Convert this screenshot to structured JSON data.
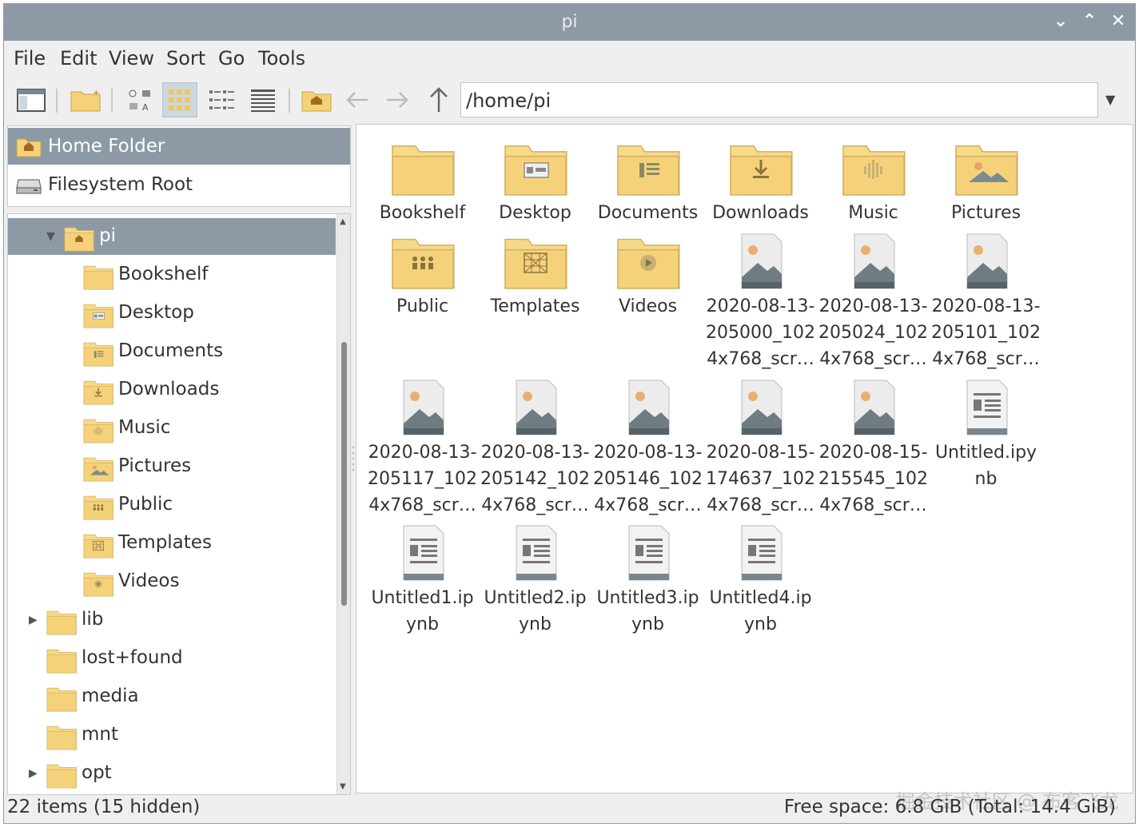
{
  "window": {
    "title": "pi"
  },
  "menubar": [
    "File",
    "Edit",
    "View",
    "Sort",
    "Go",
    "Tools"
  ],
  "path": "/home/pi",
  "places": [
    {
      "label": "Home Folder",
      "icon": "home-icon",
      "selected": true
    },
    {
      "label": "Filesystem Root",
      "icon": "drive-icon",
      "selected": false
    }
  ],
  "tree": [
    {
      "label": "pi",
      "level": 1,
      "expander": "down",
      "icon": "home-folder",
      "selected": true
    },
    {
      "label": "Bookshelf",
      "level": 2,
      "icon": "folder"
    },
    {
      "label": "Desktop",
      "level": 2,
      "icon": "desktop-folder"
    },
    {
      "label": "Documents",
      "level": 2,
      "icon": "documents-folder"
    },
    {
      "label": "Downloads",
      "level": 2,
      "icon": "downloads-folder"
    },
    {
      "label": "Music",
      "level": 2,
      "icon": "music-folder"
    },
    {
      "label": "Pictures",
      "level": 2,
      "icon": "pictures-folder"
    },
    {
      "label": "Public",
      "level": 2,
      "icon": "public-folder"
    },
    {
      "label": "Templates",
      "level": 2,
      "icon": "templates-folder"
    },
    {
      "label": "Videos",
      "level": 2,
      "icon": "videos-folder"
    },
    {
      "label": "lib",
      "level": 0,
      "expander": "right",
      "icon": "folder"
    },
    {
      "label": "lost+found",
      "level": 0,
      "icon": "folder"
    },
    {
      "label": "media",
      "level": 0,
      "icon": "folder"
    },
    {
      "label": "mnt",
      "level": 0,
      "icon": "folder"
    },
    {
      "label": "opt",
      "level": 0,
      "expander": "right",
      "icon": "folder"
    }
  ],
  "files": [
    {
      "name": "Bookshelf",
      "icon": "folder"
    },
    {
      "name": "Desktop",
      "icon": "desktop-folder"
    },
    {
      "name": "Documents",
      "icon": "documents-folder"
    },
    {
      "name": "Downloads",
      "icon": "downloads-folder"
    },
    {
      "name": "Music",
      "icon": "music-folder"
    },
    {
      "name": "Pictures",
      "icon": "pictures-folder"
    },
    {
      "name": "Public",
      "icon": "public-folder"
    },
    {
      "name": "Templates",
      "icon": "templates-folder"
    },
    {
      "name": "Videos",
      "icon": "videos-folder"
    },
    {
      "name": "2020-08-13-205000_1024x768_scr…",
      "icon": "image-file"
    },
    {
      "name": "2020-08-13-205024_1024x768_scr…",
      "icon": "image-file"
    },
    {
      "name": "2020-08-13-205101_1024x768_scr…",
      "icon": "image-file"
    },
    {
      "name": "2020-08-13-205117_1024x768_scr…",
      "icon": "image-file"
    },
    {
      "name": "2020-08-13-205142_1024x768_scr…",
      "icon": "image-file"
    },
    {
      "name": "2020-08-13-205146_1024x768_scr…",
      "icon": "image-file"
    },
    {
      "name": "2020-08-15-174637_1024x768_scr…",
      "icon": "image-file"
    },
    {
      "name": "2020-08-15-215545_1024x768_scr…",
      "icon": "image-file"
    },
    {
      "name": "Untitled.ipynb",
      "icon": "text-file"
    },
    {
      "name": "Untitled1.ipynb",
      "icon": "text-file"
    },
    {
      "name": "Untitled2.ipynb",
      "icon": "text-file"
    },
    {
      "name": "Untitled3.ipynb",
      "icon": "text-file"
    },
    {
      "name": "Untitled4.ipynb",
      "icon": "text-file"
    }
  ],
  "status": {
    "left": "22 items (15 hidden)",
    "right": "Free space: 6.8 GiB (Total: 14.4 GiB)",
    "watermark": "掘金技术社区 @ 布客飞龙"
  },
  "colors": {
    "titlebar": "#8d9aa6",
    "folder": "#f5d27a",
    "selection": "#8d9aa6"
  }
}
